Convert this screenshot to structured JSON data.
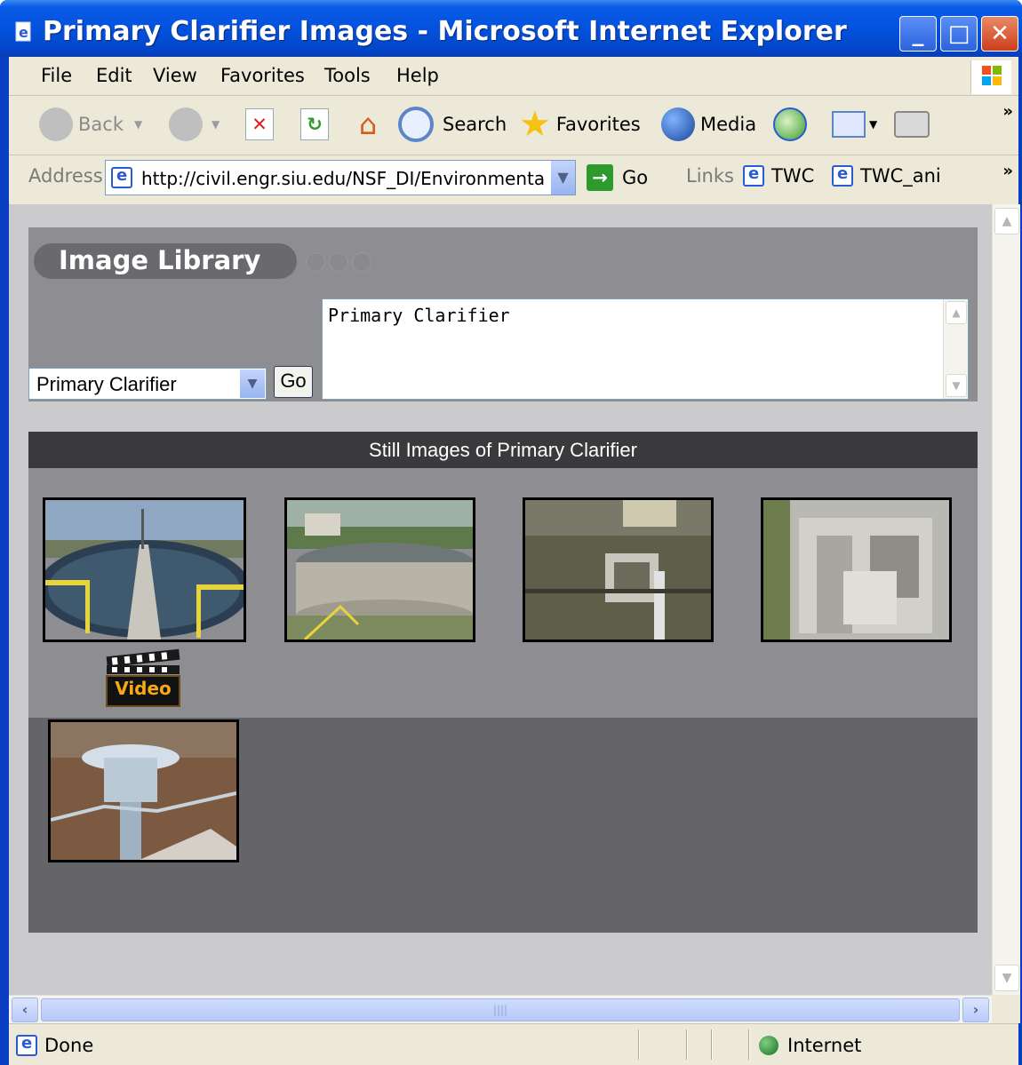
{
  "window": {
    "title": "Primary Clarifier Images - Microsoft Internet Explorer"
  },
  "menu": [
    "File",
    "Edit",
    "View",
    "Favorites",
    "Tools",
    "Help"
  ],
  "toolbar": {
    "back": "Back",
    "search": "Search",
    "favorites": "Favorites",
    "media": "Media"
  },
  "address": {
    "label": "Address",
    "url": "http://civil.engr.siu.edu/NSF_DI/Environmenta",
    "go": "Go"
  },
  "links": {
    "label": "Links",
    "items": [
      "TWC",
      "TWC_ani"
    ]
  },
  "library": {
    "title": "Image Library",
    "select_value": "Primary Clarifier",
    "go_label": "Go",
    "description": "Primary Clarifier"
  },
  "gallery": {
    "header": "Still Images of Primary Clarifier",
    "video_label": "Video",
    "thumbnails": [
      "clarifier-overview",
      "clarifier-tank",
      "clarifier-skimmer",
      "clarifier-weir",
      "clarifier-drive"
    ]
  },
  "status": {
    "text": "Done",
    "zone": "Internet"
  },
  "colors": {
    "titlebar": "#0352dd",
    "chrome": "#ece9d8",
    "panel": "#8e8d91",
    "header": "#3a393c",
    "gallery_dark": "#656468",
    "video_accent": "#f5a818"
  }
}
